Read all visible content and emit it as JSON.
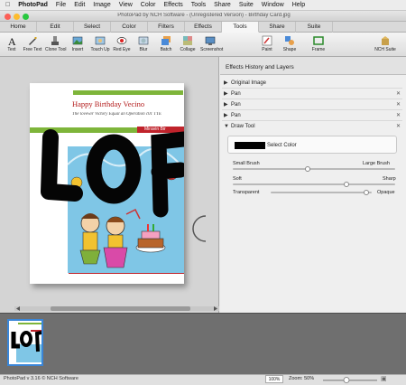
{
  "menubar": {
    "app_name": "PhotoPad",
    "items": [
      "File",
      "Edit",
      "Image",
      "View",
      "Color",
      "Effects",
      "Tools",
      "Share",
      "Suite",
      "Window",
      "Help"
    ]
  },
  "window": {
    "title": "PhotoPad by NCH Software - (Unregistered Version) - Birthday Card.jpg"
  },
  "tabs": [
    {
      "label": "Home"
    },
    {
      "label": "Edit"
    },
    {
      "label": "Select"
    },
    {
      "label": "Color"
    },
    {
      "label": "Filters"
    },
    {
      "label": "Effects"
    },
    {
      "label": "Tools"
    },
    {
      "label": "Share"
    },
    {
      "label": "Suite"
    }
  ],
  "active_tab": "Tools",
  "toolbar": {
    "tools": [
      {
        "label": "Text",
        "icon": "text-icon"
      },
      {
        "label": "Free Text",
        "icon": "free-text-icon"
      },
      {
        "label": "Clone Tool",
        "icon": "clone-tool-icon"
      },
      {
        "label": "Insert",
        "icon": "insert-image-icon"
      },
      {
        "label": "Touch Up",
        "icon": "touch-up-icon"
      },
      {
        "label": "Red Eye",
        "icon": "red-eye-icon"
      },
      {
        "label": "Blur",
        "icon": "blur-icon"
      },
      {
        "label": "Batch",
        "icon": "batch-icon"
      },
      {
        "label": "Collage",
        "icon": "collage-icon"
      },
      {
        "label": "Screenshot",
        "icon": "screenshot-icon"
      },
      {
        "label": "Paint",
        "icon": "paint-icon"
      },
      {
        "label": "Shape",
        "icon": "shape-icon"
      },
      {
        "label": "Frame",
        "icon": "frame-icon"
      },
      {
        "label": "NCH Suite",
        "icon": "nch-suite-icon"
      }
    ]
  },
  "card": {
    "title": "Happy Birthday Vecino",
    "subtitle": "The lovewir Victory Equal an Operation c01 TTE",
    "tag": "Miravin Bir",
    "scribble_text": "LOF"
  },
  "panel": {
    "title": "Effects History and Layers",
    "layers": [
      {
        "label": "Original Image"
      },
      {
        "label": "Pan"
      },
      {
        "label": "Pan"
      },
      {
        "label": "Pan"
      },
      {
        "label": "Draw Tool"
      }
    ],
    "color": {
      "label": "Select Color",
      "value": "#000000"
    },
    "brush": {
      "left_label": "Small Brush",
      "right_label": "Large Brush",
      "level": 0.46
    },
    "softness": {
      "left_label": "Soft",
      "right_label": "Sharp",
      "level": 0.7
    },
    "opacity": {
      "left_label": "Transparent",
      "right_label": "Opaque",
      "level": 0.95
    }
  },
  "statusbar": {
    "text": "PhotoPad v 3.16 © NCH Software",
    "zoom": "100%",
    "zoom_label": "Zoom: 50%"
  },
  "colors": {
    "accent": "#3a86d8",
    "card_red": "#c0232b",
    "card_green": "#7eb53a",
    "sky": "#7fc6e6"
  }
}
